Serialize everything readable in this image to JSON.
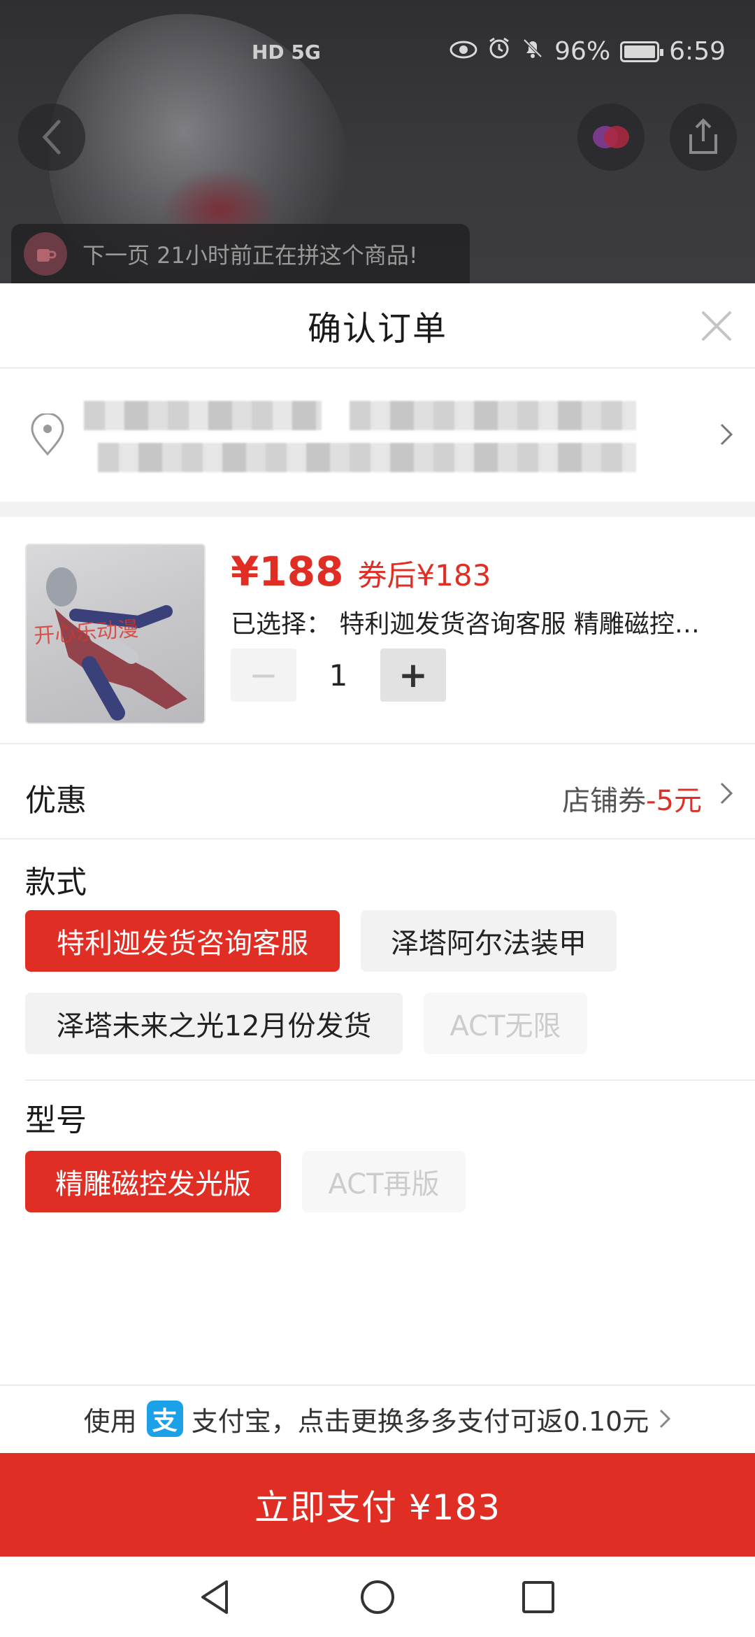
{
  "status_bar": {
    "network": "HD 5G",
    "battery": "96%",
    "time": "6:59"
  },
  "toast": {
    "text": "下一页 21小时前正在拼这个商品!"
  },
  "sheet": {
    "title": "确认订单"
  },
  "product": {
    "image_watermark": "开心乐动漫",
    "price": "¥188",
    "coupon_price": "券后¥183",
    "selected": "已选择： 特利迦发货咨询客服 精雕磁控发光版",
    "quantity": "1",
    "minus": "−",
    "plus": "+"
  },
  "discount": {
    "label": "优惠",
    "coupon_prefix": "店铺券",
    "coupon_amount": "-5元"
  },
  "style_section": {
    "label": "款式",
    "options": [
      {
        "label": "特利迦发货咨询客服",
        "state": "selected"
      },
      {
        "label": "泽塔阿尔法装甲",
        "state": "normal"
      },
      {
        "label": "泽塔未来之光12月份发货",
        "state": "normal"
      },
      {
        "label": "ACT无限",
        "state": "disabled"
      }
    ]
  },
  "model_section": {
    "label": "型号",
    "options": [
      {
        "label": "精雕磁控发光版",
        "state": "selected"
      },
      {
        "label": "ACT再版",
        "state": "disabled"
      }
    ]
  },
  "payment": {
    "note_prefix": "使用",
    "alipay_glyph": "支",
    "note_suffix": "支付宝，点击更换多多支付可返0.10元",
    "pay_button": "立即支付 ¥183"
  },
  "colors": {
    "accent": "#e02e24",
    "alipay": "#1aa1e8"
  }
}
